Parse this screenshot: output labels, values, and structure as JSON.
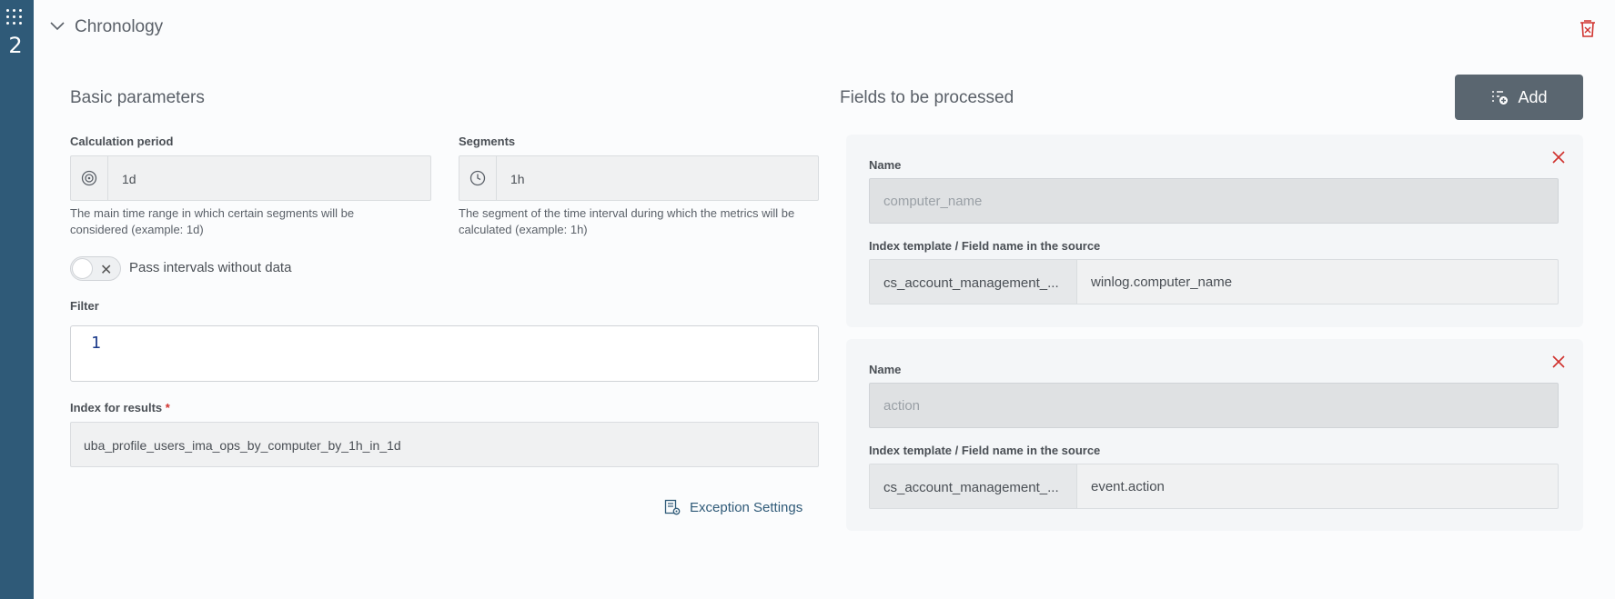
{
  "sidebar": {
    "number": "2"
  },
  "header": {
    "title": "Chronology"
  },
  "basic": {
    "title": "Basic parameters",
    "calc_period": {
      "label": "Calculation period",
      "value": "1d",
      "hint_line1": "The main time range in which certain segments will be",
      "hint_line2": "considered (example: 1d)"
    },
    "segments": {
      "label": "Segments",
      "value": "1h",
      "hint_line1": "The segment of the time interval during which the metrics will be",
      "hint_line2": "calculated (example: 1h)"
    },
    "pass_intervals": {
      "label": "Pass intervals without data",
      "checked": false
    },
    "filter": {
      "label": "Filter",
      "line_number": "1"
    },
    "index_results": {
      "label": "Index for results",
      "required_mark": "*",
      "value": "uba_profile_users_ima_ops_by_computer_by_1h_in_1d"
    },
    "exception_settings": "Exception Settings"
  },
  "fields": {
    "title": "Fields to be processed",
    "add_label": "Add",
    "items": [
      {
        "name_label": "Name",
        "name_placeholder": "computer_name",
        "source_label": "Index template / Field name in the source",
        "template": "cs_account_management_...",
        "field": "winlog.computer_name"
      },
      {
        "name_label": "Name",
        "name_placeholder": "action",
        "source_label": "Index template / Field name in the source",
        "template": "cs_account_management_...",
        "field": "event.action"
      }
    ]
  },
  "colors": {
    "sidebar": "#2f5a78",
    "danger": "#d0312d",
    "button": "#5a6670"
  }
}
